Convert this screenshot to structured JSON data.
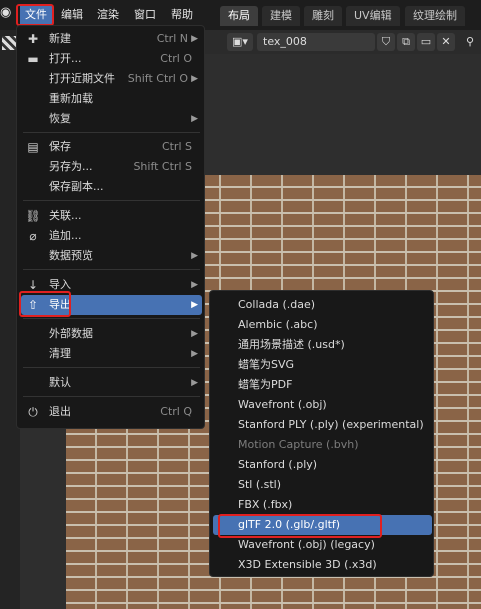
{
  "topbar": {
    "menus": [
      "文件",
      "编辑",
      "渲染",
      "窗口",
      "帮助"
    ],
    "workspace_tabs": [
      "布局",
      "建模",
      "雕刻",
      "UV编辑",
      "纹理绘制"
    ]
  },
  "image_header": {
    "image_name": "tex_008"
  },
  "file_menu": {
    "items": [
      {
        "icon": "new-file-icon",
        "label": "新建",
        "shortcut": "Ctrl N",
        "submenu": true
      },
      {
        "icon": "folder-icon",
        "label": "打开...",
        "shortcut": "Ctrl O"
      },
      {
        "icon": "",
        "label": "打开近期文件",
        "shortcut": "Shift Ctrl O",
        "submenu": true
      },
      {
        "icon": "",
        "label": "重新加载",
        "shortcut": ""
      },
      {
        "icon": "",
        "label": "恢复",
        "shortcut": "",
        "submenu": true
      },
      {
        "icon": "save-icon",
        "label": "保存",
        "shortcut": "Ctrl S"
      },
      {
        "icon": "",
        "label": "另存为...",
        "shortcut": "Shift Ctrl S"
      },
      {
        "icon": "",
        "label": "保存副本...",
        "shortcut": ""
      },
      {
        "icon": "link-icon",
        "label": "关联...",
        "shortcut": ""
      },
      {
        "icon": "paperclip-icon",
        "label": "追加...",
        "shortcut": ""
      },
      {
        "icon": "",
        "label": "数据预览",
        "shortcut": "",
        "submenu": true
      },
      {
        "icon": "import-icon",
        "label": "导入",
        "shortcut": "",
        "submenu": true
      },
      {
        "icon": "export-icon",
        "label": "导出",
        "shortcut": "",
        "submenu": true,
        "highlighted": true
      },
      {
        "icon": "",
        "label": "外部数据",
        "shortcut": "",
        "submenu": true
      },
      {
        "icon": "",
        "label": "清理",
        "shortcut": "",
        "submenu": true
      },
      {
        "icon": "",
        "label": "默认",
        "shortcut": "",
        "submenu": true
      },
      {
        "icon": "power-icon",
        "label": "退出",
        "shortcut": "Ctrl Q"
      }
    ]
  },
  "export_menu": {
    "items": [
      {
        "label": "Collada (.dae)"
      },
      {
        "label": "Alembic (.abc)"
      },
      {
        "label": "通用场景描述 (.usd*)"
      },
      {
        "label": "蜡笔为SVG"
      },
      {
        "label": "蜡笔为PDF"
      },
      {
        "label": "Wavefront (.obj)"
      },
      {
        "label": "Stanford PLY (.ply) (experimental)"
      },
      {
        "label": "Motion Capture (.bvh)",
        "disabled": true
      },
      {
        "label": "Stanford (.ply)"
      },
      {
        "label": "Stl (.stl)"
      },
      {
        "label": "FBX (.fbx)"
      },
      {
        "label": "glTF 2.0 (.glb/.gltf)",
        "highlighted": true
      },
      {
        "label": "Wavefront (.obj) (legacy)"
      },
      {
        "label": "X3D Extensible 3D (.x3d)"
      }
    ]
  },
  "colors": {
    "accent": "#4772b3",
    "annotation": "#e02020"
  }
}
